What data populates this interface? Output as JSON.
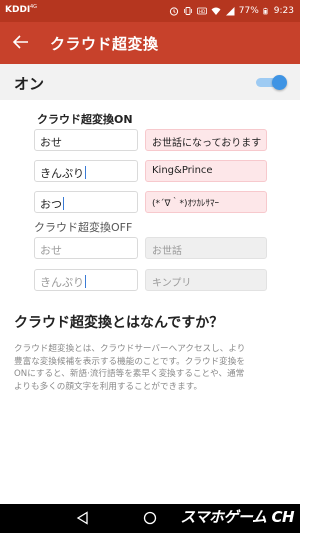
{
  "status_bar": {
    "carrier": "KDDI",
    "carrier_sub": "4G",
    "battery": "77%",
    "time": "9:23"
  },
  "app_bar": {
    "back_icon": "arrow-left-icon",
    "title": "クラウド超変換"
  },
  "toggle_row": {
    "label": "オン",
    "enabled": true,
    "accent_color": "#3f94e4"
  },
  "on_section": {
    "title": "クラウド超変換ON",
    "rows": [
      {
        "input": "おせ",
        "output": "お世話になっております"
      },
      {
        "input": "きんぷり",
        "output": "King&Prince"
      },
      {
        "input": "おつ",
        "output": "(*´∇｀*)ｵﾂｶﾚｻﾏｰ"
      }
    ]
  },
  "off_section": {
    "title": "クラウド超変換OFF",
    "rows": [
      {
        "input": "おせ",
        "output": "お世話"
      },
      {
        "input": "きんぷり",
        "output": "キンプリ"
      }
    ]
  },
  "question": "クラウド超変換とはなんですか？",
  "description_lines": [
    "クラウド超変換とは、クラウドサーバーへアクセスし、より",
    "豊富な変換候補を表示する機能のことです。クラウド変換を",
    "ONにすると、新語·流行語等を素早く変換することや、通常",
    "よりも多くの顔文字を利用することができます。"
  ],
  "watermark": {
    "text": "スマホゲーム",
    "suffix": "CH"
  },
  "colors": {
    "status_bar": "#b5361f",
    "app_bar": "#c7412b",
    "on_output_bg": "#fde7e9",
    "off_output_bg": "#efefef"
  }
}
